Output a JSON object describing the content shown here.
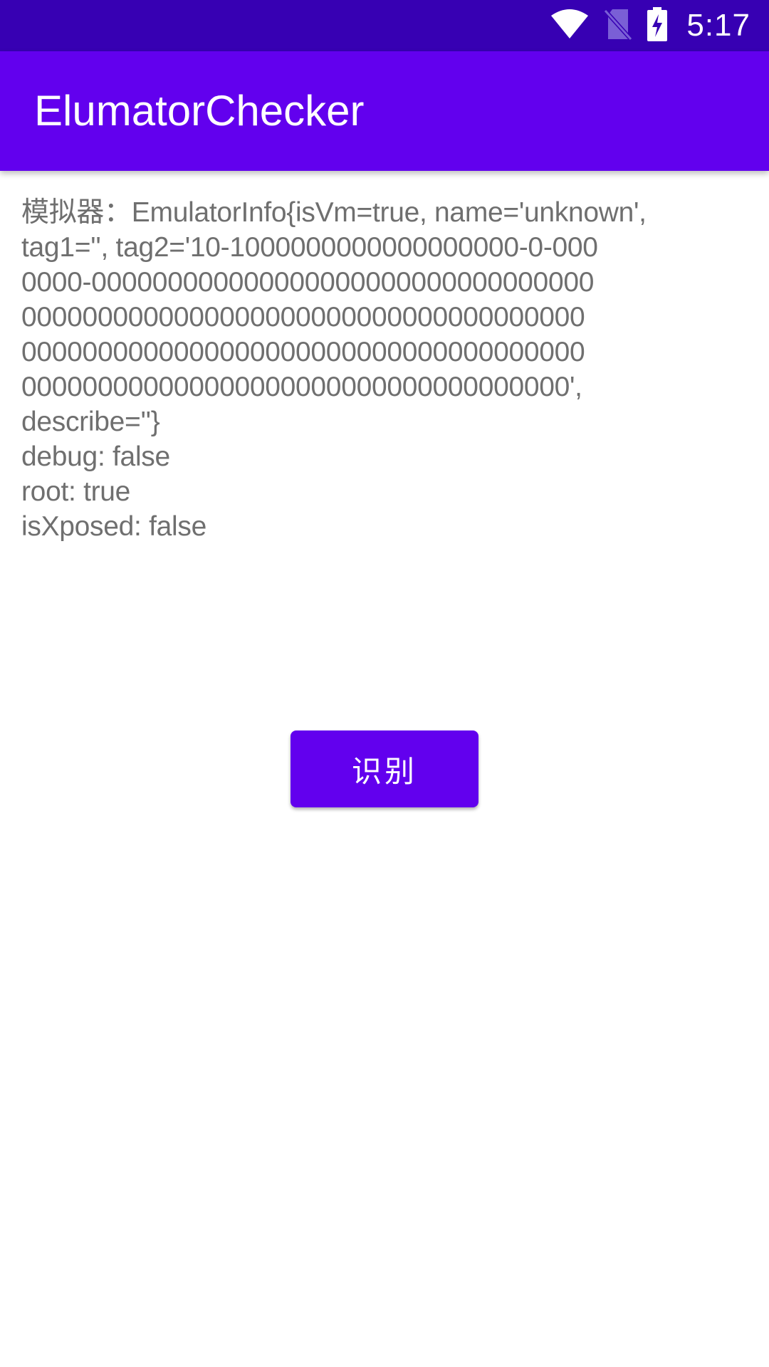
{
  "status_bar": {
    "time": "5:17",
    "icons": [
      "wifi-icon",
      "no-sim-icon",
      "battery-charging-icon"
    ],
    "color": "#3700b3"
  },
  "app_bar": {
    "title": "ElumatorChecker",
    "color": "#6200ee"
  },
  "content": {
    "lines": [
      "模拟器：EmulatorInfo{isVm=true, name='unknown',",
      "tag1='', tag2='10-1000000000000000000-0-000",
      "0000-000000000000000000000000000000000",
      "0000000000000000000000000000000000000",
      "0000000000000000000000000000000000000",
      "000000000000000000000000000000000000',",
      "describe=''}",
      "debug: false",
      "root: true",
      "isXposed: false"
    ],
    "text_color": "#6f6f6f"
  },
  "button": {
    "label": "识别",
    "color": "#6200ee"
  }
}
